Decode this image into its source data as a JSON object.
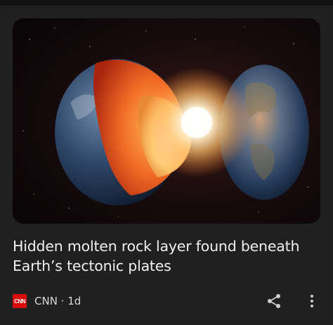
{
  "card": {
    "headline": "Hidden molten rock layer found beneath Earth’s tectonic plates",
    "source_logo_text": "CNN",
    "source_line": "CNN · 1d",
    "icons": [
      "share-icon",
      "more-vert-icon"
    ]
  },
  "colors": {
    "background": "#1f1f1f",
    "headline_text": "#f0f0f0",
    "meta_text": "#d8d8d8",
    "cnn_red": "#d90b0b"
  }
}
